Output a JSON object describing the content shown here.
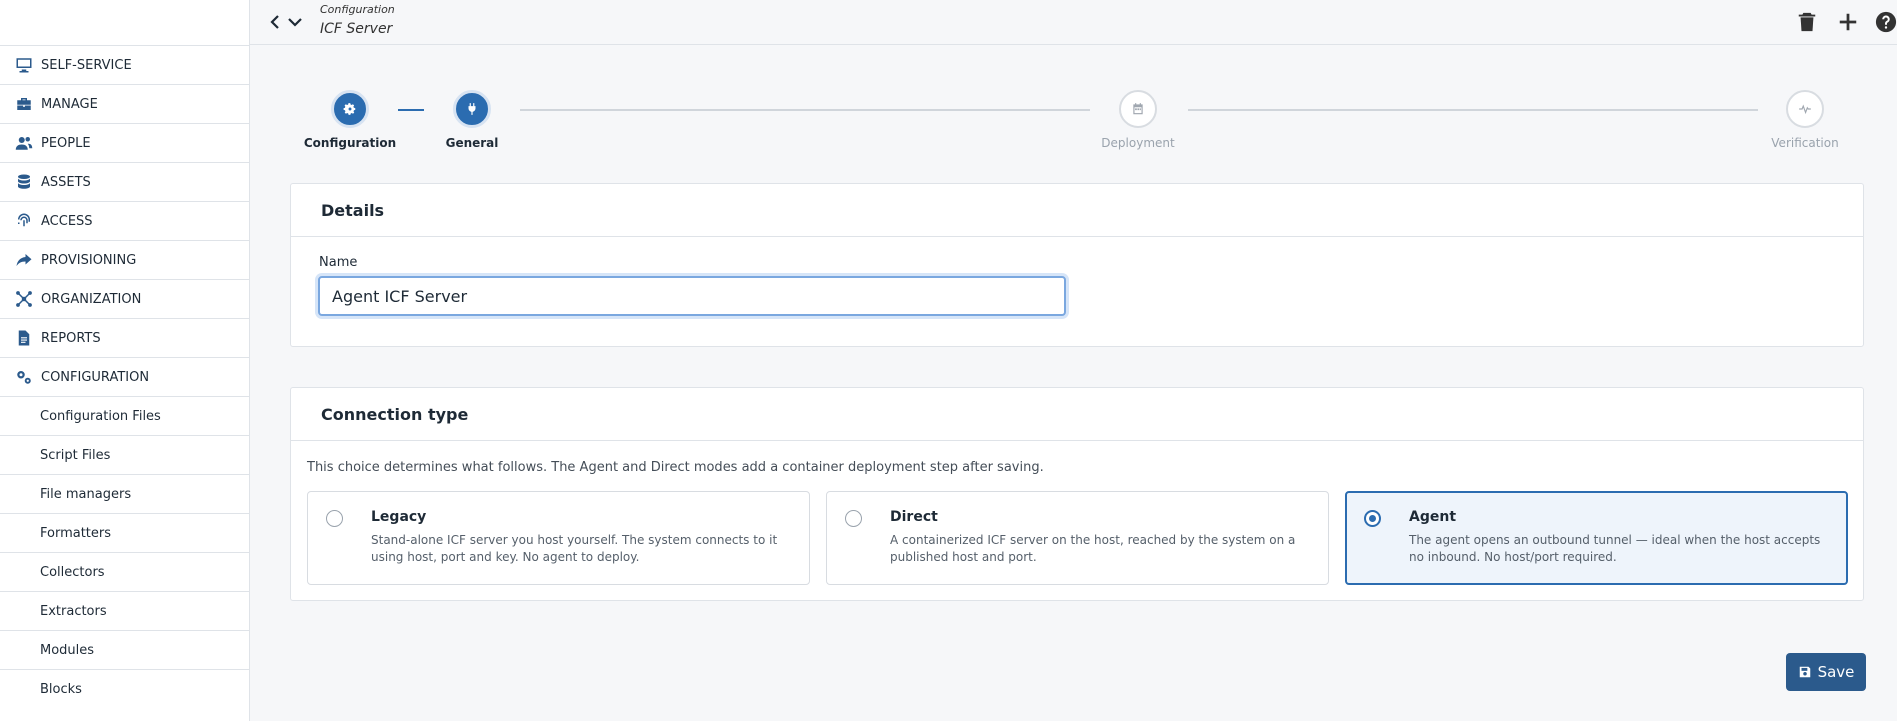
{
  "header": {
    "breadcrumb": "Configuration",
    "title": "ICF Server"
  },
  "sidebar": {
    "items": [
      {
        "label": "SELF-SERVICE",
        "icon": "monitor-icon"
      },
      {
        "label": "MANAGE",
        "icon": "toolbox-icon"
      },
      {
        "label": "PEOPLE",
        "icon": "users-icon"
      },
      {
        "label": "ASSETS",
        "icon": "database-icon"
      },
      {
        "label": "ACCESS",
        "icon": "fingerprint-icon"
      },
      {
        "label": "PROVISIONING",
        "icon": "share-arrow-icon"
      },
      {
        "label": "ORGANIZATION",
        "icon": "network-icon"
      },
      {
        "label": "REPORTS",
        "icon": "file-icon"
      },
      {
        "label": "CONFIGURATION",
        "icon": "gears-icon"
      }
    ],
    "sub_items": [
      "Configuration Files",
      "Script Files",
      "File managers",
      "Formatters",
      "Collectors",
      "Extractors",
      "Modules",
      "Blocks"
    ]
  },
  "stepper": {
    "steps": [
      {
        "label": "Configuration",
        "state": "active",
        "icon": "gear-icon"
      },
      {
        "label": "General",
        "state": "active",
        "icon": "plug-icon"
      },
      {
        "label": "Deployment",
        "state": "inactive",
        "icon": "calendar-icon"
      },
      {
        "label": "Verification",
        "state": "inactive",
        "icon": "pulse-icon"
      }
    ]
  },
  "details": {
    "title": "Details",
    "name_label": "Name",
    "name_value": "Agent ICF Server"
  },
  "connection": {
    "title": "Connection type",
    "description": "This choice determines what follows. The Agent and Direct modes add a container deployment step after saving.",
    "options": [
      {
        "title": "Legacy",
        "description": "Stand-alone ICF server you host yourself. The system connects to it using host, port and key. No agent to deploy.",
        "selected": false
      },
      {
        "title": "Direct",
        "description": "A containerized ICF server on the host, reached by the system on a published host and port.",
        "selected": false
      },
      {
        "title": "Agent",
        "description": "The agent opens an outbound tunnel — ideal when the host accepts no inbound. No host/port required.",
        "selected": true
      }
    ]
  },
  "actions": {
    "save_label": "Save"
  },
  "colors": {
    "accent": "#2b6cb0",
    "nav_icon": "#2b5a8c",
    "save_button": "#2b5a8c"
  }
}
